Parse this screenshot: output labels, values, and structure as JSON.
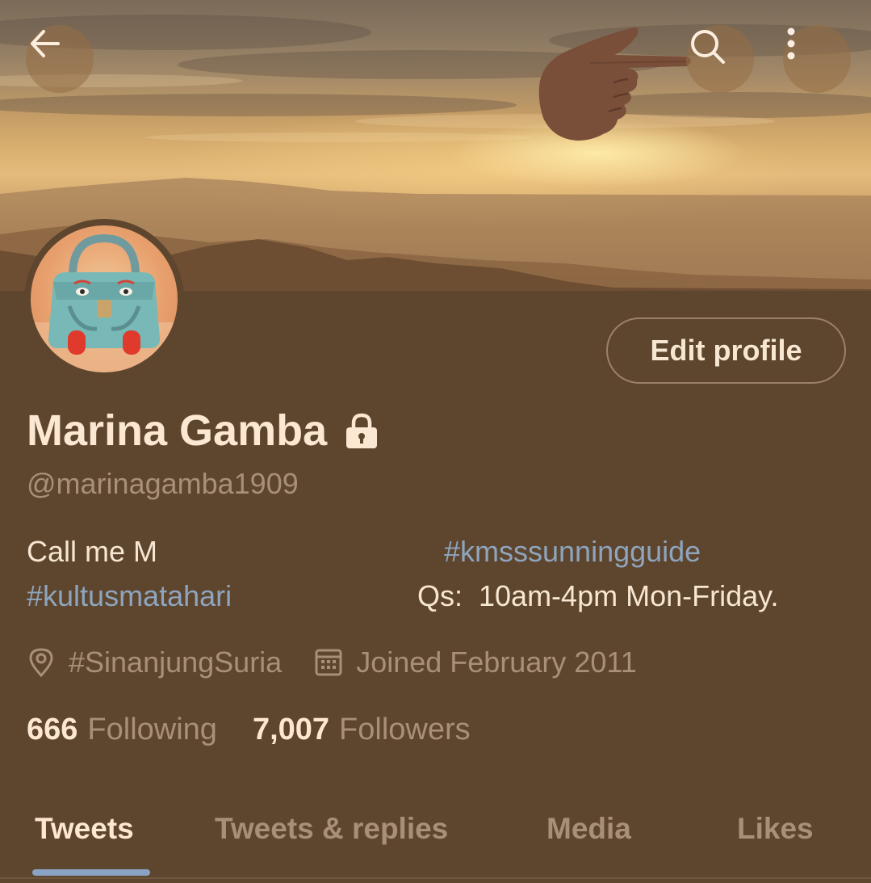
{
  "header": {
    "back_icon": "arrow-left-icon",
    "search_icon": "search-icon",
    "more_icon": "more-vertical-icon",
    "pointer_icon": "pointing-hand-icon"
  },
  "profile": {
    "name": "Marina Gamba",
    "lock_icon": "lock-icon",
    "handle": "@marinagamba1909",
    "edit_label": "Edit profile",
    "bio": {
      "line1_left": "Call me M",
      "line1_right_tag": "#kmsssunningguide",
      "line2_left_tag": "#kultusmatahari",
      "line2_right": "Qs:  10am-4pm Mon-Friday."
    },
    "location": "#SinanjungSuria",
    "joined": "Joined February 2011",
    "following_count": "666",
    "following_label": "Following",
    "followers_count": "7,007",
    "followers_label": "Followers"
  },
  "tabs": [
    {
      "label": "Tweets",
      "active": true
    },
    {
      "label": "Tweets & replies",
      "active": false
    },
    {
      "label": "Media",
      "active": false
    },
    {
      "label": "Likes",
      "active": false
    }
  ],
  "colors": {
    "background": "#5e452e",
    "primary_text": "#fbe7d2",
    "secondary_text": "#a88f77",
    "link": "#8ea5bd",
    "tab_indicator": "#8aa3c4"
  }
}
